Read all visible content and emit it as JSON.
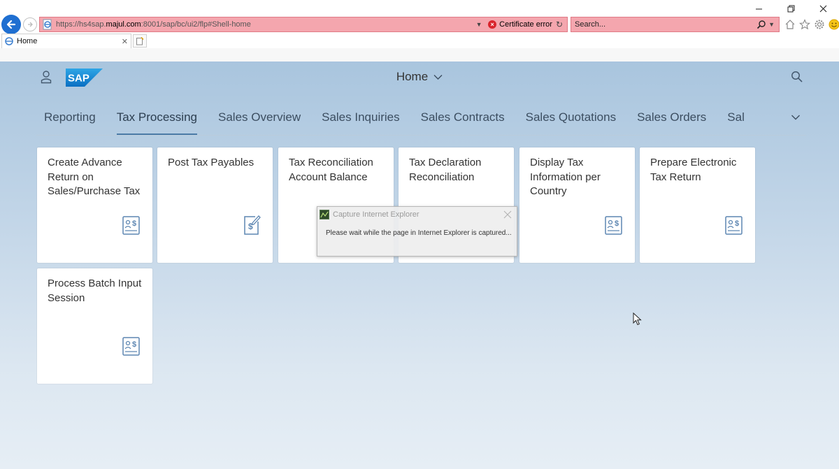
{
  "browser": {
    "address": {
      "url_prefix": "https://hs4sap.",
      "url_host": "majul.com",
      "url_rest": ":8001/sap/bc/ui2/flp#Shell-home",
      "certificate_error": "Certificate error"
    },
    "search": {
      "placeholder": "Search..."
    },
    "tabs": [
      {
        "label": "Home"
      }
    ],
    "colors": {
      "address_bar_error": "#f4a6ae",
      "back_button": "#1f6fd1"
    }
  },
  "shell": {
    "title": "Home",
    "nav_tabs": [
      {
        "label": "Reporting"
      },
      {
        "label": "Tax Processing",
        "active": true
      },
      {
        "label": "Sales Overview"
      },
      {
        "label": "Sales Inquiries"
      },
      {
        "label": "Sales Contracts"
      },
      {
        "label": "Sales Quotations"
      },
      {
        "label": "Sales Orders"
      },
      {
        "label": "Sal"
      }
    ],
    "tiles": [
      {
        "title": "Create Advance Return on Sales/Purchase Tax",
        "icon": "tax-document-icon"
      },
      {
        "title": "Post Tax Payables",
        "icon": "tax-edit-icon"
      },
      {
        "title": "Tax Reconciliation Account Balance",
        "icon": "tax-document-icon"
      },
      {
        "title": "Tax Declaration Reconciliation",
        "icon": "tax-document-icon"
      },
      {
        "title": "Display Tax Information per Country",
        "icon": "tax-document-icon"
      },
      {
        "title": "Prepare Electronic Tax Return",
        "icon": "tax-document-icon"
      },
      {
        "title": "Process Batch Input Session",
        "icon": "tax-document-icon"
      }
    ],
    "colors": {
      "accent": "#4a7ba7",
      "tile_icon": "#5d86b2"
    }
  },
  "capture_dialog": {
    "title": "Capture Internet Explorer",
    "message": "Please wait while the page in Internet Explorer is captured..."
  }
}
